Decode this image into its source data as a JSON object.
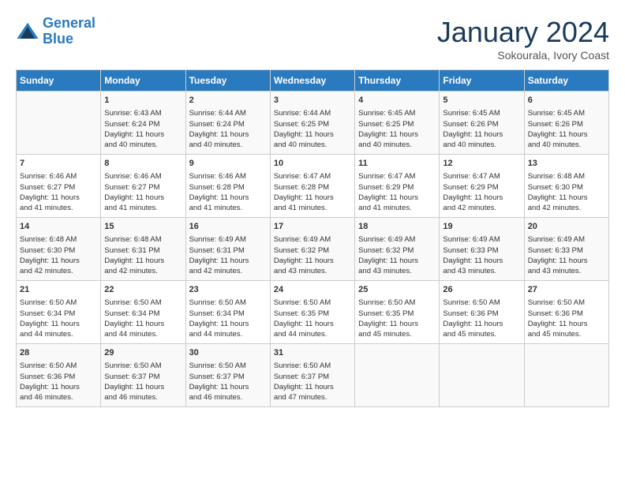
{
  "header": {
    "logo_line1": "General",
    "logo_line2": "Blue",
    "month": "January 2024",
    "location": "Sokourala, Ivory Coast"
  },
  "weekdays": [
    "Sunday",
    "Monday",
    "Tuesday",
    "Wednesday",
    "Thursday",
    "Friday",
    "Saturday"
  ],
  "weeks": [
    [
      {
        "day": "",
        "info": ""
      },
      {
        "day": "1",
        "info": "Sunrise: 6:43 AM\nSunset: 6:24 PM\nDaylight: 11 hours\nand 40 minutes."
      },
      {
        "day": "2",
        "info": "Sunrise: 6:44 AM\nSunset: 6:24 PM\nDaylight: 11 hours\nand 40 minutes."
      },
      {
        "day": "3",
        "info": "Sunrise: 6:44 AM\nSunset: 6:25 PM\nDaylight: 11 hours\nand 40 minutes."
      },
      {
        "day": "4",
        "info": "Sunrise: 6:45 AM\nSunset: 6:25 PM\nDaylight: 11 hours\nand 40 minutes."
      },
      {
        "day": "5",
        "info": "Sunrise: 6:45 AM\nSunset: 6:26 PM\nDaylight: 11 hours\nand 40 minutes."
      },
      {
        "day": "6",
        "info": "Sunrise: 6:45 AM\nSunset: 6:26 PM\nDaylight: 11 hours\nand 40 minutes."
      }
    ],
    [
      {
        "day": "7",
        "info": "Sunrise: 6:46 AM\nSunset: 6:27 PM\nDaylight: 11 hours\nand 41 minutes."
      },
      {
        "day": "8",
        "info": "Sunrise: 6:46 AM\nSunset: 6:27 PM\nDaylight: 11 hours\nand 41 minutes."
      },
      {
        "day": "9",
        "info": "Sunrise: 6:46 AM\nSunset: 6:28 PM\nDaylight: 11 hours\nand 41 minutes."
      },
      {
        "day": "10",
        "info": "Sunrise: 6:47 AM\nSunset: 6:28 PM\nDaylight: 11 hours\nand 41 minutes."
      },
      {
        "day": "11",
        "info": "Sunrise: 6:47 AM\nSunset: 6:29 PM\nDaylight: 11 hours\nand 41 minutes."
      },
      {
        "day": "12",
        "info": "Sunrise: 6:47 AM\nSunset: 6:29 PM\nDaylight: 11 hours\nand 42 minutes."
      },
      {
        "day": "13",
        "info": "Sunrise: 6:48 AM\nSunset: 6:30 PM\nDaylight: 11 hours\nand 42 minutes."
      }
    ],
    [
      {
        "day": "14",
        "info": "Sunrise: 6:48 AM\nSunset: 6:30 PM\nDaylight: 11 hours\nand 42 minutes."
      },
      {
        "day": "15",
        "info": "Sunrise: 6:48 AM\nSunset: 6:31 PM\nDaylight: 11 hours\nand 42 minutes."
      },
      {
        "day": "16",
        "info": "Sunrise: 6:49 AM\nSunset: 6:31 PM\nDaylight: 11 hours\nand 42 minutes."
      },
      {
        "day": "17",
        "info": "Sunrise: 6:49 AM\nSunset: 6:32 PM\nDaylight: 11 hours\nand 43 minutes."
      },
      {
        "day": "18",
        "info": "Sunrise: 6:49 AM\nSunset: 6:32 PM\nDaylight: 11 hours\nand 43 minutes."
      },
      {
        "day": "19",
        "info": "Sunrise: 6:49 AM\nSunset: 6:33 PM\nDaylight: 11 hours\nand 43 minutes."
      },
      {
        "day": "20",
        "info": "Sunrise: 6:49 AM\nSunset: 6:33 PM\nDaylight: 11 hours\nand 43 minutes."
      }
    ],
    [
      {
        "day": "21",
        "info": "Sunrise: 6:50 AM\nSunset: 6:34 PM\nDaylight: 11 hours\nand 44 minutes."
      },
      {
        "day": "22",
        "info": "Sunrise: 6:50 AM\nSunset: 6:34 PM\nDaylight: 11 hours\nand 44 minutes."
      },
      {
        "day": "23",
        "info": "Sunrise: 6:50 AM\nSunset: 6:34 PM\nDaylight: 11 hours\nand 44 minutes."
      },
      {
        "day": "24",
        "info": "Sunrise: 6:50 AM\nSunset: 6:35 PM\nDaylight: 11 hours\nand 44 minutes."
      },
      {
        "day": "25",
        "info": "Sunrise: 6:50 AM\nSunset: 6:35 PM\nDaylight: 11 hours\nand 45 minutes."
      },
      {
        "day": "26",
        "info": "Sunrise: 6:50 AM\nSunset: 6:36 PM\nDaylight: 11 hours\nand 45 minutes."
      },
      {
        "day": "27",
        "info": "Sunrise: 6:50 AM\nSunset: 6:36 PM\nDaylight: 11 hours\nand 45 minutes."
      }
    ],
    [
      {
        "day": "28",
        "info": "Sunrise: 6:50 AM\nSunset: 6:36 PM\nDaylight: 11 hours\nand 46 minutes."
      },
      {
        "day": "29",
        "info": "Sunrise: 6:50 AM\nSunset: 6:37 PM\nDaylight: 11 hours\nand 46 minutes."
      },
      {
        "day": "30",
        "info": "Sunrise: 6:50 AM\nSunset: 6:37 PM\nDaylight: 11 hours\nand 46 minutes."
      },
      {
        "day": "31",
        "info": "Sunrise: 6:50 AM\nSunset: 6:37 PM\nDaylight: 11 hours\nand 47 minutes."
      },
      {
        "day": "",
        "info": ""
      },
      {
        "day": "",
        "info": ""
      },
      {
        "day": "",
        "info": ""
      }
    ]
  ]
}
